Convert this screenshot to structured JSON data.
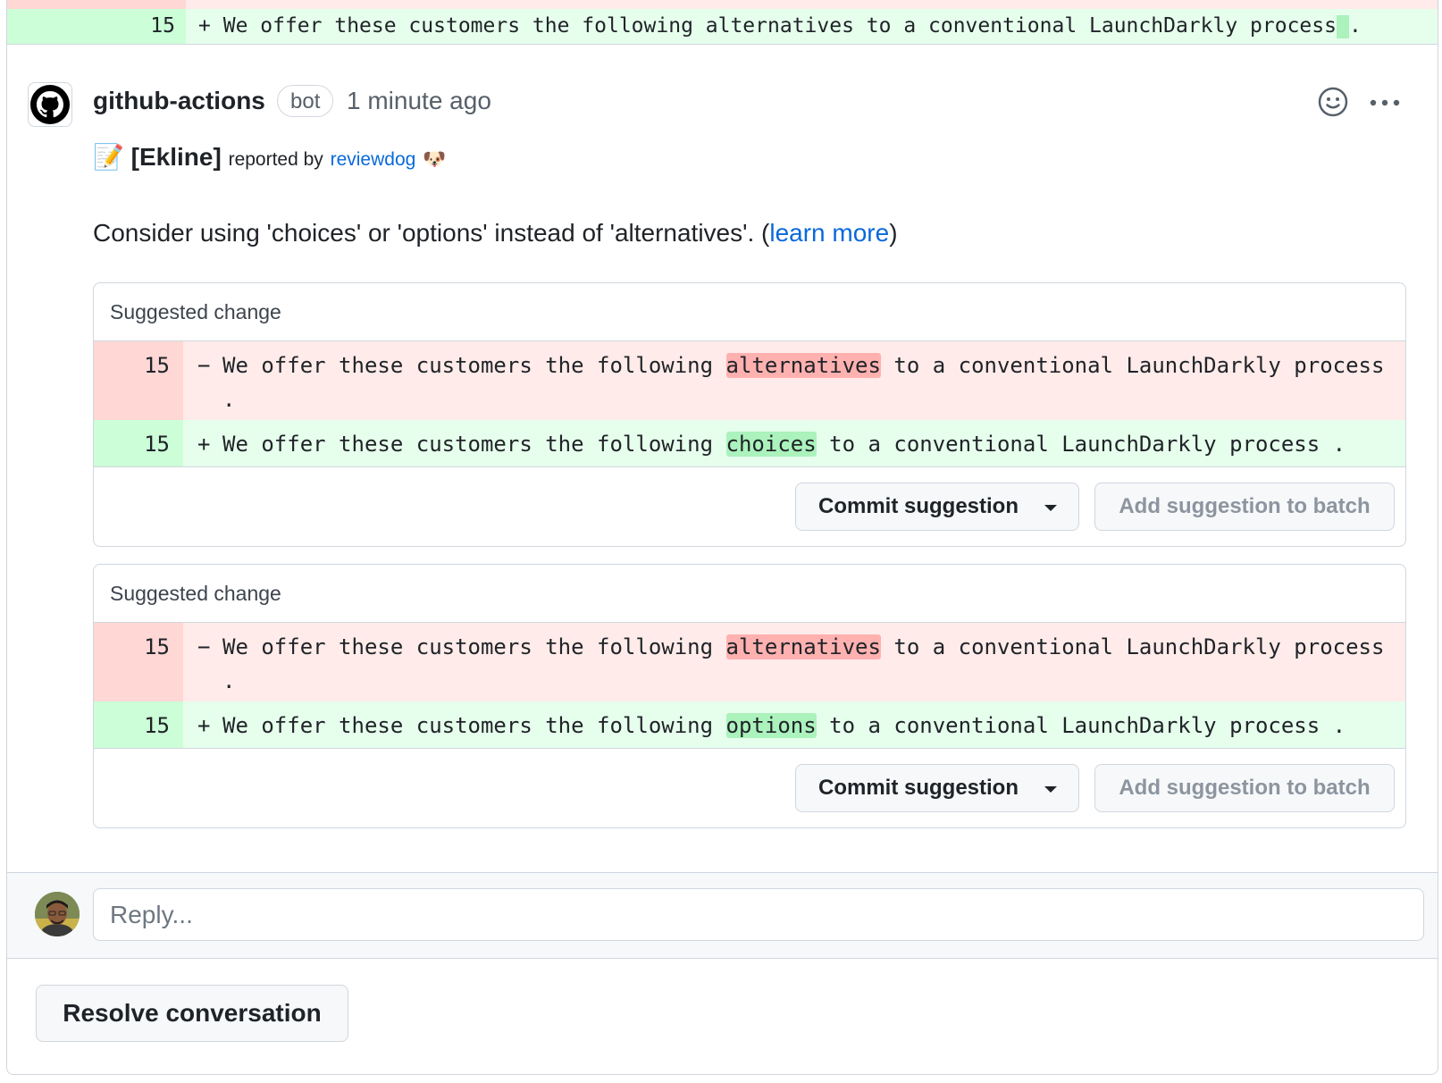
{
  "top_diff": {
    "line_number": "15",
    "sign": "+",
    "text": "We offer these customers the following alternatives to a conventional LaunchDarkly process",
    "tail": "."
  },
  "comment": {
    "author": "github-actions",
    "badge": "bot",
    "timestamp": "1 minute ago",
    "icons": [
      "github-logo-icon",
      "smiley-icon",
      "kebab-menu-icon",
      "memo-emoji-icon",
      "dog-emoji-icon"
    ],
    "header_tag": "[Ekline]",
    "reported_by": "reported by",
    "reporter_link": "reviewdog",
    "memo_emoji": "📝",
    "dog_emoji": "🐶",
    "message_prefix": "Consider using 'choices' or 'options' instead of 'alternatives'. (",
    "message_link": "learn more",
    "message_suffix": ")"
  },
  "suggestions": [
    {
      "title": "Suggested change",
      "del_line_number": "15",
      "del_sign": "−",
      "del_before": "We offer these customers the following ",
      "del_highlight": "alternatives",
      "del_after": " to a conventional LaunchDarkly process .",
      "add_line_number": "15",
      "add_sign": "+",
      "add_before": "We offer these customers the following ",
      "add_highlight": "choices",
      "add_after": " to a conventional LaunchDarkly process .",
      "commit_label": "Commit suggestion",
      "batch_label": "Add suggestion to batch"
    },
    {
      "title": "Suggested change",
      "del_line_number": "15",
      "del_sign": "−",
      "del_before": "We offer these customers the following ",
      "del_highlight": "alternatives",
      "del_after": " to a conventional LaunchDarkly process .",
      "add_line_number": "15",
      "add_sign": "+",
      "add_before": "We offer these customers the following ",
      "add_highlight": "options",
      "add_after": " to a conventional LaunchDarkly process .",
      "commit_label": "Commit suggestion",
      "batch_label": "Add suggestion to batch"
    }
  ],
  "reply": {
    "placeholder": "Reply..."
  },
  "resolve_label": "Resolve conversation",
  "colors": {
    "link": "#0969da",
    "del_bg": "#ffebe9",
    "del_highlight": "#ff8182",
    "add_bg": "#e6ffec",
    "add_highlight": "#abf2bc"
  }
}
